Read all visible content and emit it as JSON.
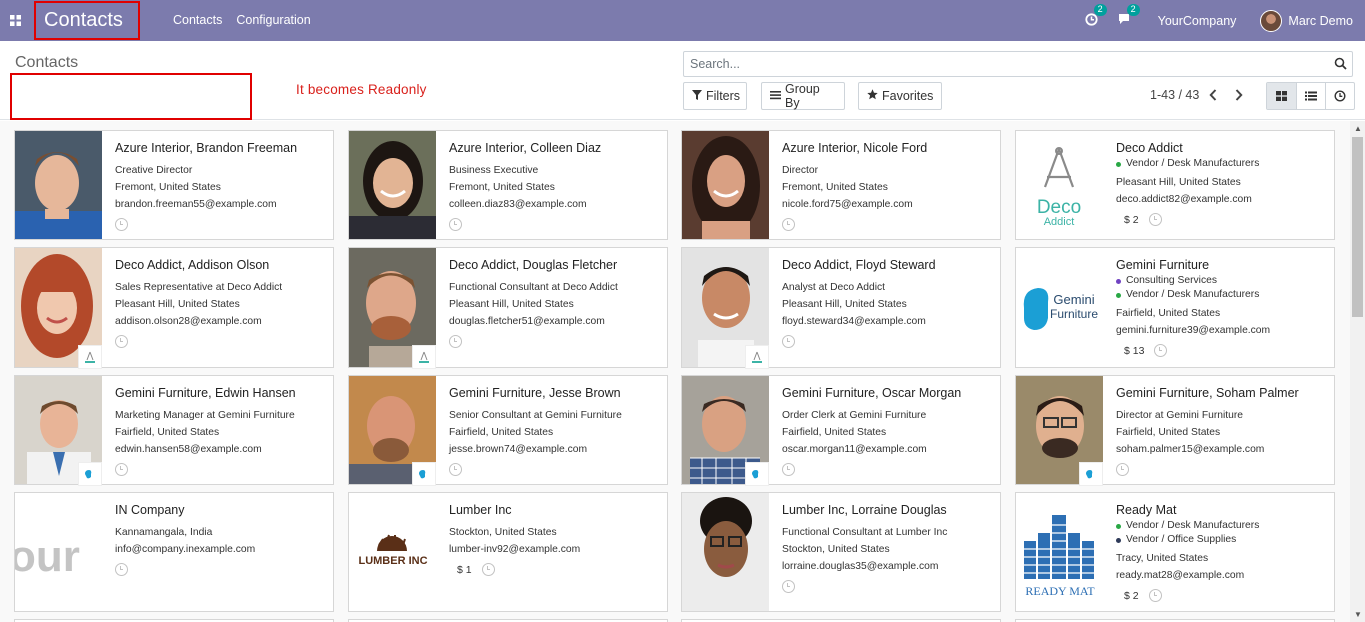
{
  "navbar": {
    "brand": "Contacts",
    "menu": [
      "Contacts",
      "Configuration"
    ],
    "activity_count": "2",
    "message_count": "2",
    "company": "YourCompany",
    "user": "Marc Demo"
  },
  "control_panel": {
    "breadcrumb": "Contacts",
    "annotation": "It becomes Readonly",
    "search_placeholder": "Search...",
    "filters_label": "Filters",
    "groupby_label": "Group By",
    "favorites_label": "Favorites",
    "pager": "1-43 / 43"
  },
  "colors": {
    "navbar": "#7c7bad",
    "highlight": "#e00000",
    "annotation": "#d9201b",
    "tag_green": "#28a745",
    "tag_purple": "#6f42c1"
  },
  "cards": [
    {
      "name": "Azure Interior, Brandon Freeman",
      "lines": [
        "Creative Director",
        "Fremont, United States",
        "brandon.freeman55@example.com"
      ],
      "tags": [],
      "amount": ""
    },
    {
      "name": "Azure Interior, Colleen Diaz",
      "lines": [
        "Business Executive",
        "Fremont, United States",
        "colleen.diaz83@example.com"
      ],
      "tags": [],
      "amount": ""
    },
    {
      "name": "Azure Interior, Nicole Ford",
      "lines": [
        "Director",
        "Fremont, United States",
        "nicole.ford75@example.com"
      ],
      "tags": [],
      "amount": ""
    },
    {
      "name": "Deco Addict",
      "lines": [
        "Pleasant Hill, United States",
        "deco.addict82@example.com"
      ],
      "tags": [
        "Vendor / Desk Manufacturers"
      ],
      "amount": "$ 2"
    },
    {
      "name": "Deco Addict, Addison Olson",
      "lines": [
        "Sales Representative at Deco Addict",
        "Pleasant Hill, United States",
        "addison.olson28@example.com"
      ],
      "tags": [],
      "amount": ""
    },
    {
      "name": "Deco Addict, Douglas Fletcher",
      "lines": [
        "Functional Consultant at Deco Addict",
        "Pleasant Hill, United States",
        "douglas.fletcher51@example.com"
      ],
      "tags": [],
      "amount": ""
    },
    {
      "name": "Deco Addict, Floyd Steward",
      "lines": [
        "Analyst at Deco Addict",
        "Pleasant Hill, United States",
        "floyd.steward34@example.com"
      ],
      "tags": [],
      "amount": ""
    },
    {
      "name": "Gemini Furniture",
      "lines": [
        "Fairfield, United States",
        "gemini.furniture39@example.com"
      ],
      "tags": [
        "Consulting Services",
        "Vendor / Desk Manufacturers"
      ],
      "amount": "$ 13"
    },
    {
      "name": "Gemini Furniture, Edwin Hansen",
      "lines": [
        "Marketing Manager at Gemini Furniture",
        "Fairfield, United States",
        "edwin.hansen58@example.com"
      ],
      "tags": [],
      "amount": ""
    },
    {
      "name": "Gemini Furniture, Jesse Brown",
      "lines": [
        "Senior Consultant at Gemini Furniture",
        "Fairfield, United States",
        "jesse.brown74@example.com"
      ],
      "tags": [],
      "amount": ""
    },
    {
      "name": "Gemini Furniture, Oscar Morgan",
      "lines": [
        "Order Clerk at Gemini Furniture",
        "Fairfield, United States",
        "oscar.morgan11@example.com"
      ],
      "tags": [],
      "amount": ""
    },
    {
      "name": "Gemini Furniture, Soham Palmer",
      "lines": [
        "Director at Gemini Furniture",
        "Fairfield, United States",
        "soham.palmer15@example.com"
      ],
      "tags": [],
      "amount": ""
    },
    {
      "name": "IN Company",
      "lines": [
        "Kannamangala, India",
        "info@company.inexample.com"
      ],
      "tags": [],
      "amount": ""
    },
    {
      "name": "Lumber Inc",
      "lines": [
        "Stockton, United States",
        "lumber-inv92@example.com"
      ],
      "tags": [],
      "amount": "$ 1"
    },
    {
      "name": "Lumber Inc, Lorraine Douglas",
      "lines": [
        "Functional Consultant at Lumber Inc",
        "Stockton, United States",
        "lorraine.douglas35@example.com"
      ],
      "tags": [],
      "amount": ""
    },
    {
      "name": "Ready Mat",
      "lines": [
        "Tracy, United States",
        "ready.mat28@example.com"
      ],
      "tags": [
        "Vendor / Desk Manufacturers",
        "Vendor / Office Supplies"
      ],
      "amount": "$ 2"
    }
  ],
  "logos": {
    "deco_top": "Deco",
    "deco_bottom": "Addict",
    "gemini_top": "Gemini",
    "gemini_bottom": "Furniture",
    "in_company": "our",
    "lumber": "LUMBER INC",
    "readymat": "READY MAT"
  }
}
